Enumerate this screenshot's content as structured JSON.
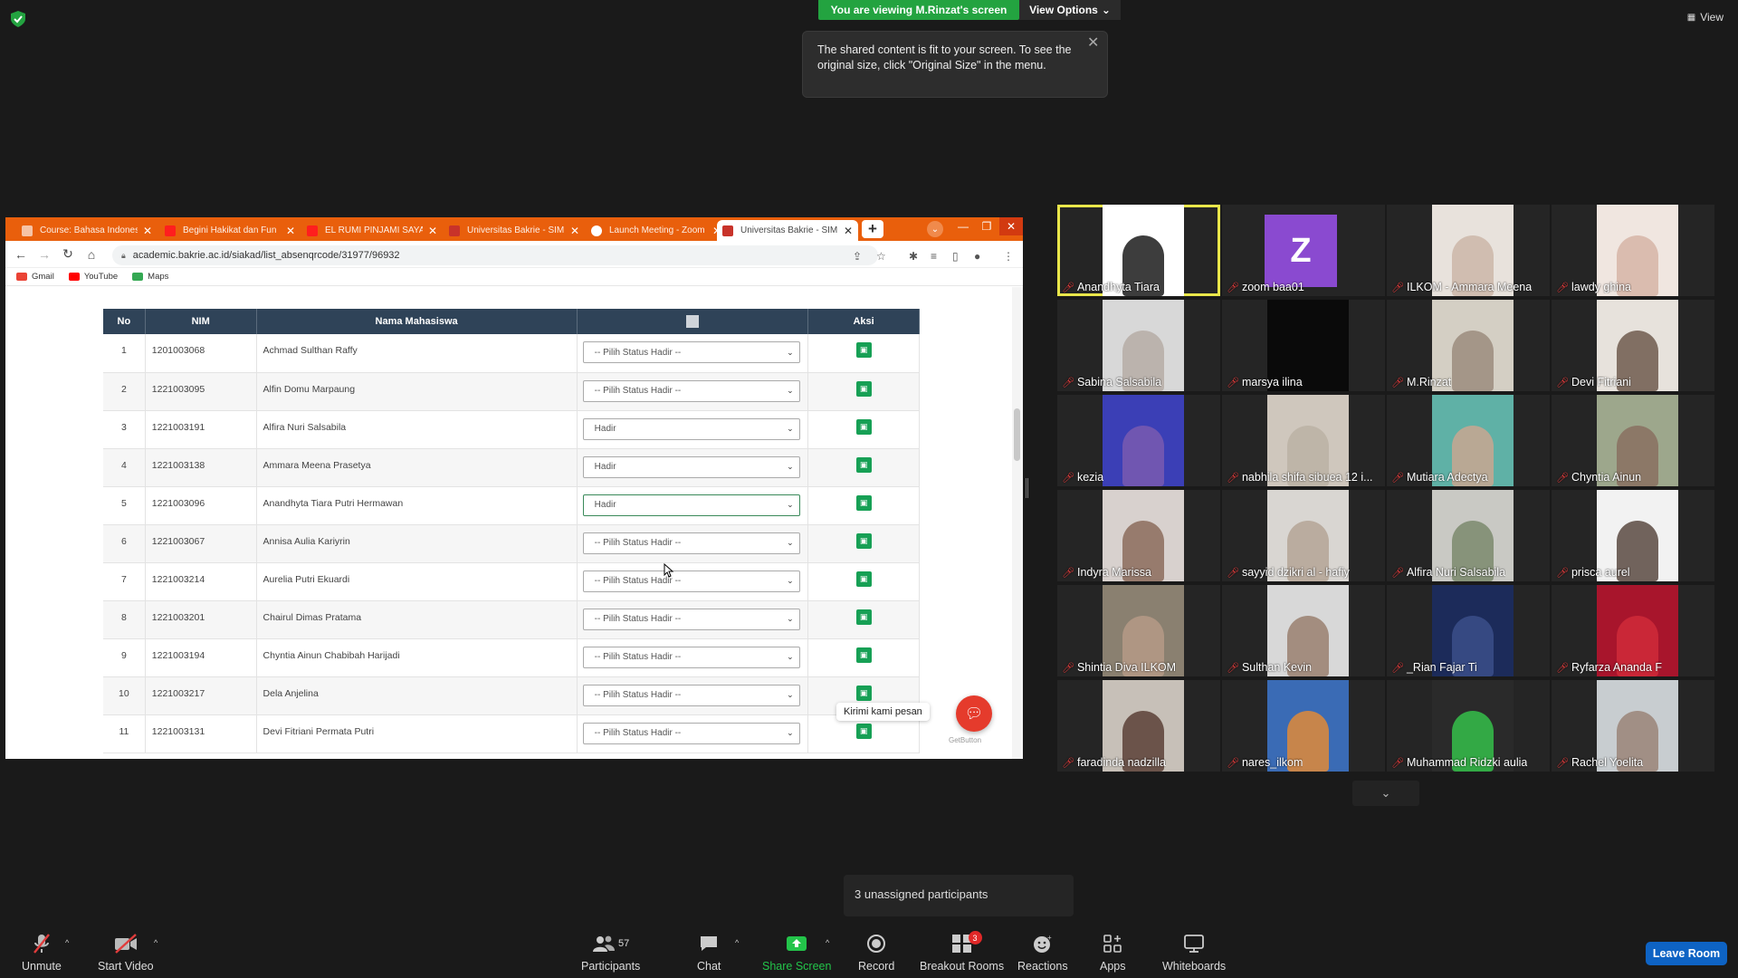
{
  "meeting": {
    "viewing_banner": "You are viewing M.Rinzat's screen",
    "view_options": "View Options",
    "view_label": "View",
    "tooltip": "The shared content is fit to your screen. To see the original size, click \"Original Size\" in the menu.",
    "unassigned": "3 unassigned participants",
    "colors": {
      "banner": "#23a340",
      "leave": "#0e63c4",
      "active_speaker": "#e9e64a",
      "accent_tab": "#e95f0c"
    }
  },
  "browser": {
    "tabs": [
      {
        "label": "Course: Bahasa Indonesi",
        "icon": "course-icon"
      },
      {
        "label": "Begini Hakikat dan Fun",
        "icon": "youtube-icon"
      },
      {
        "label": "EL RUMI PINJAMI SAYA",
        "icon": "youtube-icon"
      },
      {
        "label": "Universitas Bakrie - SIM",
        "icon": "shield-icon"
      },
      {
        "label": "Launch Meeting - Zoom",
        "icon": "globe-icon"
      },
      {
        "label": "Universitas Bakrie - SIM",
        "icon": "shield-icon"
      }
    ],
    "url": "academic.bakrie.ac.id/siakad/list_absenqrcode/31977/96932",
    "bookmarks": [
      "Gmail",
      "YouTube",
      "Maps"
    ]
  },
  "attendance": {
    "headers": {
      "no": "No",
      "nim": "NIM",
      "nama": "Nama Mahasiswa",
      "aksi": "Aksi"
    },
    "rows": [
      {
        "no": "1",
        "nim": "1201003068",
        "nama": "Achmad Sulthan Raffy",
        "status": "-- Pilih Status Hadir --"
      },
      {
        "no": "2",
        "nim": "1221003095",
        "nama": "Alfin Domu Marpaung",
        "status": "-- Pilih Status Hadir --"
      },
      {
        "no": "3",
        "nim": "1221003191",
        "nama": "Alfira Nuri Salsabila",
        "status": "Hadir"
      },
      {
        "no": "4",
        "nim": "1221003138",
        "nama": "Ammara Meena Prasetya",
        "status": "Hadir"
      },
      {
        "no": "5",
        "nim": "1221003096",
        "nama": "Anandhyta Tiara Putri Hermawan",
        "status": "Hadir"
      },
      {
        "no": "6",
        "nim": "1221003067",
        "nama": "Annisa Aulia Kariyrin",
        "status": "-- Pilih Status Hadir --"
      },
      {
        "no": "7",
        "nim": "1221003214",
        "nama": "Aurelia Putri Ekuardi",
        "status": "-- Pilih Status Hadir --"
      },
      {
        "no": "8",
        "nim": "1221003201",
        "nama": "Chairul Dimas Pratama",
        "status": "-- Pilih Status Hadir --"
      },
      {
        "no": "9",
        "nim": "1221003194",
        "nama": "Chyntia Ainun Chabibah Harijadi",
        "status": "-- Pilih Status Hadir --"
      },
      {
        "no": "10",
        "nim": "1221003217",
        "nama": "Dela Anjelina",
        "status": "-- Pilih Status Hadir --"
      },
      {
        "no": "11",
        "nim": "1221003131",
        "nama": "Devi Fitriani Permata Putri",
        "status": "-- Pilih Status Hadir --"
      }
    ],
    "chat_label": "Kirimi kami pesan",
    "getbutton": "GetButton"
  },
  "participants": [
    {
      "name": "Anandhyta Tiara",
      "active": true,
      "bg": "#ffffff",
      "img": "#1b1b1b"
    },
    {
      "name": "zoom baa01",
      "avatar": "Z"
    },
    {
      "name": "ILKOM - Ammara Meena",
      "bg": "#e8e2dc",
      "img": "#cbb6a8"
    },
    {
      "name": "lawdy ghina",
      "bg": "#f0e6e0",
      "img": "#d6b4a6"
    },
    {
      "name": "Sabina Salsabila",
      "bg": "#d8d8d8",
      "img": "#b6ada6"
    },
    {
      "name": "marsya ilina",
      "bg": "#0a0a0a",
      "img": "#0a0a0a"
    },
    {
      "name": "M.Rinzat",
      "bg": "#d4cfc4",
      "img": "#9b8c7e"
    },
    {
      "name": "Devi Fitriani",
      "bg": "#e7e2dc",
      "img": "#6e5a4e"
    },
    {
      "name": "kezia",
      "bg": "#3b3fb6",
      "img": "#7a5ab0"
    },
    {
      "name": "nabhila shifa sibuea 12 i...",
      "bg": "#cfc7bd",
      "img": "#bbb1a4"
    },
    {
      "name": "Mutiara Adectya",
      "bg": "#5fb1a6",
      "img": "#c9a791"
    },
    {
      "name": "Chyntia Ainun",
      "bg": "#9da78c",
      "img": "#8a7060"
    },
    {
      "name": "Indyra Marissa",
      "bg": "#d8d1ce",
      "img": "#8c6c5c"
    },
    {
      "name": "sayyid dzikri al - hafiy",
      "bg": "#d9d6d2",
      "img": "#b4a597"
    },
    {
      "name": "Alfira Nuri Salsabila",
      "bg": "#c9c9c4",
      "img": "#7b8a6d"
    },
    {
      "name": "prisca aurel",
      "bg": "#f2f2f2",
      "img": "#5a4a42"
    },
    {
      "name": "Shintia Diva ILKOM",
      "bg": "#8a8070",
      "img": "#b59a86"
    },
    {
      "name": "Sulthan Kevin",
      "bg": "#d8d8d8",
      "img": "#9a8070"
    },
    {
      "name": "_Rian Fajar Ti",
      "bg": "#1c2b5a",
      "img": "#3b4f8a"
    },
    {
      "name": "Ryfarza Ananda F",
      "bg": "#a8152c",
      "img": "#d02a3a"
    },
    {
      "name": "faradinda nadzilla",
      "bg": "#c7c0b8",
      "img": "#5a4036"
    },
    {
      "name": "nares_ilkom",
      "bg": "#3a6bb5",
      "img": "#e08a38"
    },
    {
      "name": "Muhammad Ridzki aulia",
      "bg": "#2a2a2a",
      "img": "#35c04a"
    },
    {
      "name": "Rachel Yoelita",
      "bg": "#c8cdd0",
      "img": "#9a8478"
    }
  ],
  "toolbar": {
    "unmute": "Unmute",
    "start_video": "Start Video",
    "participants": "Participants",
    "participants_count": "57",
    "chat": "Chat",
    "share_screen": "Share Screen",
    "record": "Record",
    "breakout_rooms": "Breakout Rooms",
    "breakout_badge": "3",
    "reactions": "Reactions",
    "apps": "Apps",
    "whiteboards": "Whiteboards",
    "leave_room": "Leave Room"
  }
}
